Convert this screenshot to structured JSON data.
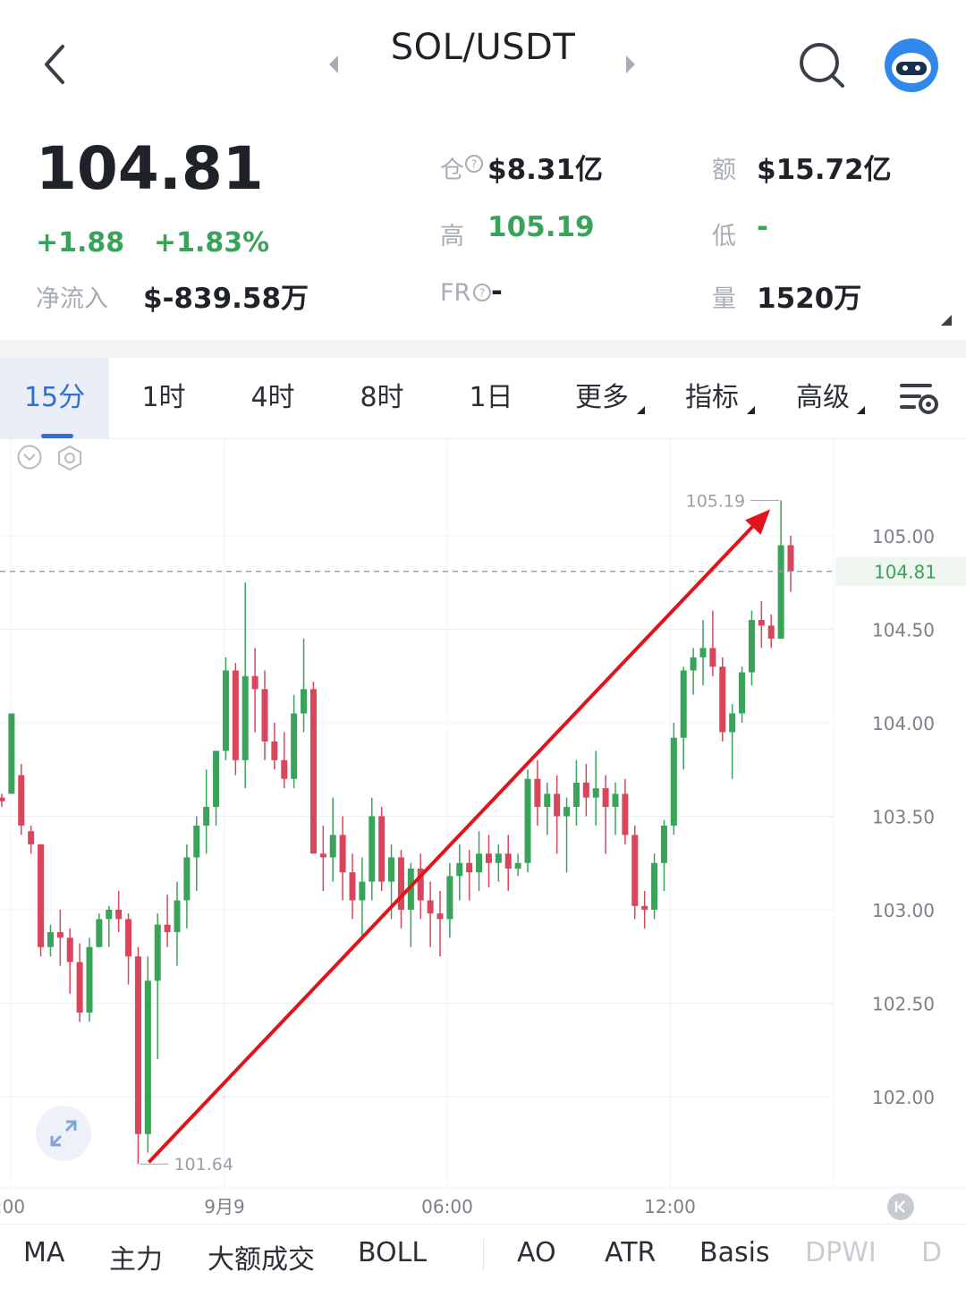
{
  "header": {
    "pair": "SOL/USDT",
    "icons": [
      "back-icon",
      "prev-pair-icon",
      "next-pair-icon",
      "search-icon",
      "bot-avatar-icon"
    ]
  },
  "stats": {
    "price": "104.81",
    "change_abs": "+1.88",
    "change_pct": "+1.83%",
    "net_inflow_label": "净流入",
    "net_inflow_value": "$-839.58万",
    "oi_label": "仓",
    "oi_value": "$8.31亿",
    "turnover_label": "额",
    "turnover_value": "$15.72亿",
    "high_label": "高",
    "high_value": "105.19",
    "low_label": "低",
    "low_value": "-",
    "fr_label": "FR",
    "fr_value": "-",
    "volume_label": "量",
    "volume_value": "1520万"
  },
  "tabs": {
    "items": [
      "15分",
      "1时",
      "4时",
      "8时",
      "1日",
      "更多",
      "指标",
      "高级"
    ],
    "active": "15分"
  },
  "chart_data": {
    "type": "candlestick",
    "interval": "15分",
    "last_price": 104.81,
    "high_marker": "105.19",
    "low_marker": "101.64",
    "y_ticks": [
      "105.00",
      "104.50",
      "104.00",
      "103.50",
      "103.00",
      "102.50",
      "102.00"
    ],
    "ylim": [
      101.55,
      105.45
    ],
    "x_ticks": [
      ":00",
      "9月9",
      "06:00",
      "12:00"
    ],
    "colors": {
      "up": "#3aa35a",
      "down": "#d9455b",
      "arrow": "#e0151b",
      "grid": "#edf0f3"
    },
    "candles": [
      [
        103.6,
        103.62,
        103.55,
        103.58
      ],
      [
        103.62,
        103.75,
        103.62,
        104.05
      ],
      [
        103.72,
        103.78,
        103.4,
        103.45
      ],
      [
        103.42,
        103.45,
        103.3,
        103.35
      ],
      [
        103.35,
        103.35,
        102.75,
        102.8
      ],
      [
        102.8,
        102.92,
        102.75,
        102.88
      ],
      [
        102.88,
        103.0,
        102.7,
        102.85
      ],
      [
        102.85,
        102.9,
        102.55,
        102.72
      ],
      [
        102.72,
        102.82,
        102.4,
        102.45
      ],
      [
        102.45,
        102.85,
        102.4,
        102.8
      ],
      [
        102.8,
        102.98,
        102.8,
        102.95
      ],
      [
        102.95,
        103.02,
        102.8,
        103.0
      ],
      [
        103.0,
        103.1,
        102.88,
        102.95
      ],
      [
        102.95,
        102.98,
        102.6,
        102.75
      ],
      [
        102.75,
        102.8,
        101.64,
        101.8
      ],
      [
        101.8,
        102.75,
        101.7,
        102.62
      ],
      [
        102.62,
        102.98,
        102.2,
        102.92
      ],
      [
        102.92,
        103.08,
        102.8,
        102.88
      ],
      [
        102.88,
        103.15,
        102.7,
        103.05
      ],
      [
        103.05,
        103.35,
        102.9,
        103.28
      ],
      [
        103.28,
        103.5,
        103.1,
        103.45
      ],
      [
        103.45,
        103.75,
        103.3,
        103.55
      ],
      [
        103.55,
        103.85,
        103.45,
        103.85
      ],
      [
        103.85,
        104.35,
        103.8,
        104.28
      ],
      [
        104.28,
        104.32,
        103.72,
        103.8
      ],
      [
        103.8,
        104.75,
        103.65,
        104.25
      ],
      [
        104.25,
        104.4,
        103.95,
        104.18
      ],
      [
        104.18,
        104.28,
        103.8,
        103.9
      ],
      [
        103.9,
        104.0,
        103.75,
        103.8
      ],
      [
        103.8,
        103.95,
        103.65,
        103.7
      ],
      [
        103.7,
        104.15,
        103.65,
        104.05
      ],
      [
        104.05,
        104.45,
        103.95,
        104.18
      ],
      [
        104.18,
        104.22,
        103.55,
        103.3
      ],
      [
        103.3,
        103.45,
        103.1,
        103.28
      ],
      [
        103.28,
        103.6,
        103.15,
        103.4
      ],
      [
        103.4,
        103.5,
        103.05,
        103.2
      ],
      [
        103.2,
        103.3,
        102.95,
        103.05
      ],
      [
        103.05,
        103.28,
        102.85,
        103.15
      ],
      [
        103.15,
        103.6,
        103.05,
        103.5
      ],
      [
        103.5,
        103.55,
        103.1,
        103.15
      ],
      [
        103.15,
        103.35,
        102.95,
        103.28
      ],
      [
        103.28,
        103.32,
        102.9,
        103.0
      ],
      [
        103.0,
        103.25,
        102.8,
        103.22
      ],
      [
        103.22,
        103.3,
        102.95,
        103.05
      ],
      [
        103.05,
        103.15,
        102.8,
        102.98
      ],
      [
        102.98,
        103.1,
        102.75,
        102.95
      ],
      [
        102.95,
        103.25,
        102.85,
        103.18
      ],
      [
        103.18,
        103.35,
        103.05,
        103.25
      ],
      [
        103.25,
        103.32,
        103.05,
        103.2
      ],
      [
        103.2,
        103.42,
        103.1,
        103.3
      ],
      [
        103.3,
        103.4,
        103.12,
        103.25
      ],
      [
        103.25,
        103.35,
        103.15,
        103.3
      ],
      [
        103.3,
        103.4,
        103.1,
        103.22
      ],
      [
        103.22,
        103.3,
        103.18,
        103.25
      ],
      [
        103.25,
        103.75,
        103.2,
        103.7
      ],
      [
        103.7,
        103.8,
        103.45,
        103.55
      ],
      [
        103.55,
        103.68,
        103.4,
        103.62
      ],
      [
        103.62,
        103.72,
        103.3,
        103.5
      ],
      [
        103.5,
        103.6,
        103.2,
        103.55
      ],
      [
        103.55,
        103.8,
        103.45,
        103.68
      ],
      [
        103.68,
        103.78,
        103.5,
        103.6
      ],
      [
        103.6,
        103.85,
        103.45,
        103.65
      ],
      [
        103.65,
        103.72,
        103.3,
        103.55
      ],
      [
        103.55,
        103.68,
        103.4,
        103.62
      ],
      [
        103.62,
        103.7,
        103.35,
        103.4
      ],
      [
        103.4,
        103.45,
        102.95,
        103.02
      ],
      [
        103.02,
        103.1,
        102.9,
        103.0
      ],
      [
        103.0,
        103.3,
        102.95,
        103.25
      ],
      [
        103.25,
        103.48,
        103.1,
        103.45
      ],
      [
        103.45,
        104.0,
        103.4,
        103.92
      ],
      [
        103.92,
        104.3,
        103.75,
        104.28
      ],
      [
        104.28,
        104.4,
        104.15,
        104.35
      ],
      [
        104.35,
        104.55,
        104.2,
        104.4
      ],
      [
        104.4,
        104.6,
        104.25,
        104.3
      ],
      [
        104.3,
        104.35,
        103.9,
        103.95
      ],
      [
        103.95,
        104.1,
        103.7,
        104.05
      ],
      [
        104.05,
        104.3,
        104.0,
        104.27
      ],
      [
        104.27,
        104.6,
        104.2,
        104.55
      ],
      [
        104.55,
        104.65,
        104.4,
        104.52
      ],
      [
        104.52,
        104.58,
        104.4,
        104.45
      ],
      [
        104.45,
        105.19,
        104.45,
        104.95
      ],
      [
        104.95,
        105.0,
        104.7,
        104.81
      ]
    ]
  },
  "bottombar": {
    "items": [
      "MA",
      "主力",
      "大额成交",
      "BOLL",
      "AO",
      "ATR",
      "Basis",
      "DPWI",
      "D"
    ]
  }
}
